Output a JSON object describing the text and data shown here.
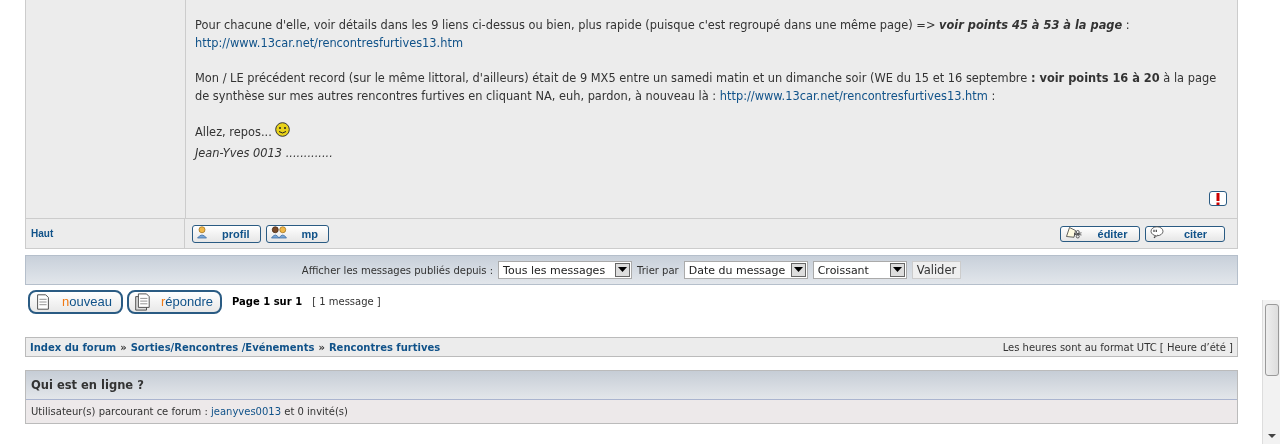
{
  "post": {
    "paragraphs": [
      [
        {
          "kind": "text",
          "text": "Pour chacune d'elle, voir détails dans les 9 liens ci-dessus ou bien, plus rapide (puisque c'est regroupé dans une même page) => "
        },
        {
          "kind": "bolditalic",
          "text": "voir points 45 à 53 à la page"
        },
        {
          "kind": "text",
          "text": " : "
        },
        {
          "kind": "link",
          "text": "http://www.13car.net/rencontresfurtives13.htm"
        }
      ],
      [
        {
          "kind": "text",
          "text": "Mon / LE précédent record (sur le même littoral, d'ailleurs) était de 9 MX5 entre un samedi matin et un dimanche soir (WE du 15 et 16 septembre "
        },
        {
          "kind": "bold",
          "text": ": voir points 16 à 20"
        },
        {
          "kind": "text",
          "text": " à la page de synthèse sur mes autres rencontres furtives en cliquant NA, euh, pardon, à nouveau là : "
        },
        {
          "kind": "link",
          "text": "http://www.13car.net/rencontresfurtives13.htm"
        },
        {
          "kind": "text",
          "text": " :"
        }
      ],
      [
        {
          "kind": "text",
          "text": "Allez, repos... "
        },
        {
          "kind": "smiley"
        }
      ]
    ],
    "signature": "Jean-Yves 0013 .............",
    "top_link": "Haut",
    "left_buttons": [
      {
        "kind": "profile",
        "label": "profil"
      },
      {
        "kind": "message",
        "label": "mp"
      }
    ],
    "right_buttons": [
      {
        "kind": "edit",
        "label": "éditer"
      },
      {
        "kind": "quote",
        "label": "citer"
      }
    ]
  },
  "sort_bar": {
    "show_label": "Afficher les messages publiés depuis :",
    "show_value": "Tous les messages",
    "sort_label": "Trier par",
    "sort_value": "Date du message",
    "order_value": "Croissant",
    "submit": "Valider"
  },
  "actions": [
    {
      "kind": "new",
      "label": "nouveau"
    },
    {
      "kind": "reply",
      "label": "répondre"
    }
  ],
  "pagination": {
    "page": "Page 1 sur 1",
    "count": "[ 1 message ]"
  },
  "breadcrumbs": [
    {
      "kind": "link",
      "text": "Index du forum"
    },
    {
      "kind": "separator",
      "text": "»"
    },
    {
      "kind": "link",
      "text": "Sorties/Rencontres /Evénements"
    },
    {
      "kind": "separator",
      "text": "»"
    },
    {
      "kind": "link",
      "text": "Rencontres furtives"
    }
  ],
  "timezone": "Les heures sont au format UTC [ Heure d’été ]",
  "online": {
    "title": "Qui est en ligne ?",
    "prefix": "Utilisateur(s) parcourant ce forum : ",
    "user": "jeanyves0013",
    "suffix": " et 0 invité(s)"
  }
}
